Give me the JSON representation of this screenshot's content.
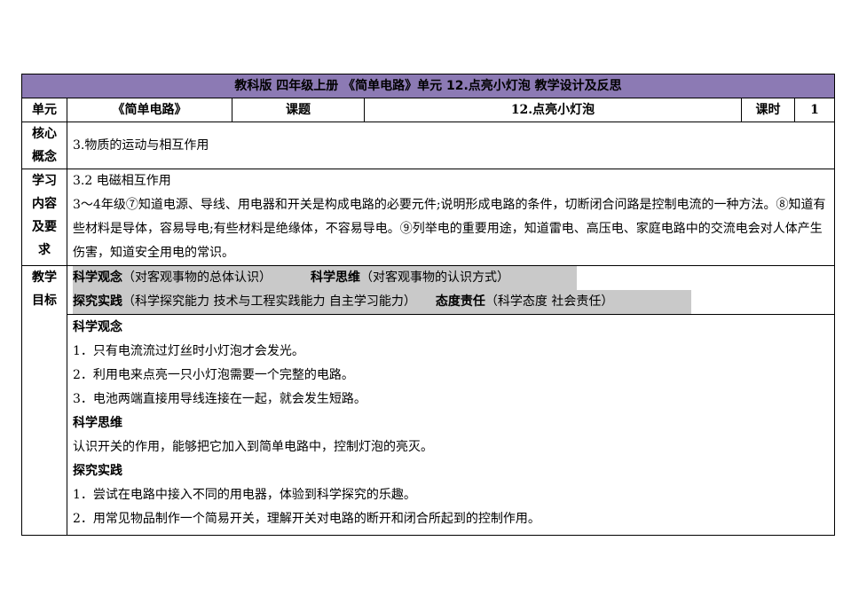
{
  "title": "教科版  四年级上册 《简单电路》单元   12.点亮小灯泡     教学设计及反思",
  "header": {
    "unit_label": "单元",
    "unit_value": "《简单电路》",
    "topic_label": "课题",
    "topic_value": "12.点亮小灯泡",
    "period_label": "课时",
    "period_value": "1"
  },
  "core": {
    "label": [
      "核心",
      "概念"
    ],
    "value": "3.物质的运动与相互作用"
  },
  "requirements": {
    "label": [
      "学习",
      "内容",
      "及要",
      "求"
    ],
    "heading": "3.2  电磁相互作用",
    "body": "3～4年级⑦知道电源、导线、用电器和开关是构成电路的必要元件;说明形成电路的条件，切断闭合问路是控制电流的一种方法。⑧知道有些材料是导体，容易导电;有些材料是绝缘体，不容易导电。⑨列举电的重要用途，知道雷电、高压电、家庭电路中的交流电会对人体产生伤害，知道安全用电的常识。"
  },
  "objectives": {
    "label": [
      "教学",
      "目标"
    ],
    "bar1": {
      "a_bold": "科学观念",
      "a_note": "（对客观事物的总体认识）",
      "b_bold": "科学思维",
      "b_note": "（对客观事物的认识方式）"
    },
    "bar2": {
      "a_bold": "探究实践",
      "a_note": "（科学探究能力 技术与工程实践能力 自主学习能力）",
      "b_bold": "态度责任",
      "b_note": "（科学态度 社会责任）"
    },
    "sections": [
      {
        "heading": "科学观念",
        "items": [
          "1．只有电流流过灯丝时小灯泡才会发光。",
          "2．利用电来点亮一只小灯泡需要一个完整的电路。",
          "3．电池两端直接用导线连接在一起，就会发生短路。"
        ]
      },
      {
        "heading": "科学思维",
        "items": [
          "认识开关的作用，能够把它加入到简单电路中，控制灯泡的亮灭。"
        ]
      },
      {
        "heading": "探究实践",
        "items": [
          "1．尝试在电路中接入不同的用电器，体验到科学探究的乐趣。",
          "2．用常见物品制作一个简易开关，理解开关对电路的断开和闭合所起到的控制作用。"
        ]
      }
    ]
  }
}
